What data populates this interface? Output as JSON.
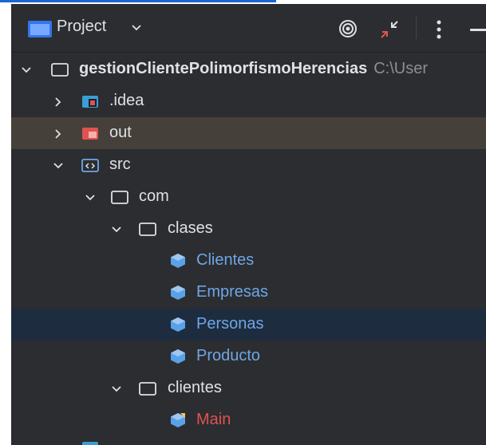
{
  "header": {
    "title": "Project",
    "icons": [
      "folder-icon",
      "chevron-down-icon",
      "target-icon",
      "collapse-icon",
      "more-vertical-icon",
      "minimize-icon"
    ]
  },
  "tree": {
    "root": {
      "label": "gestionClientePolimorfismoHerencias",
      "path": "C:\\User"
    },
    "idea": {
      "label": ".idea"
    },
    "out": {
      "label": "out"
    },
    "src": {
      "label": "src"
    },
    "com": {
      "label": "com"
    },
    "clases": {
      "label": "clases"
    },
    "clases_items": [
      "Clientes",
      "Empresas",
      "Personas",
      "Producto"
    ],
    "clientes": {
      "label": "clientes"
    },
    "main": {
      "label": "Main"
    }
  },
  "colors": {
    "panel_bg": "#2b2d30",
    "selected_out": "#45403a",
    "selected_row": "#1e2c3f",
    "class_text": "#6fa6e6",
    "main_text": "#e05252",
    "accent": "#1a66d2"
  }
}
